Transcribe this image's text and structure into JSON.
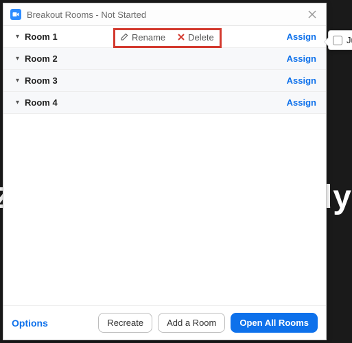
{
  "background": {
    "right_text": "Idy",
    "left_text": "Z"
  },
  "titlebar": {
    "title": "Breakout Rooms - Not Started"
  },
  "rooms": [
    {
      "name": "Room 1",
      "assign": "Assign"
    },
    {
      "name": "Room 2",
      "assign": "Assign"
    },
    {
      "name": "Room 3",
      "assign": "Assign"
    },
    {
      "name": "Room 4",
      "assign": "Assign"
    }
  ],
  "row_actions": {
    "rename": "Rename",
    "delete": "Delete"
  },
  "footer": {
    "options": "Options",
    "recreate": "Recreate",
    "add_room": "Add a Room",
    "open_all": "Open All Rooms"
  },
  "popover": {
    "participant": "Judy"
  }
}
